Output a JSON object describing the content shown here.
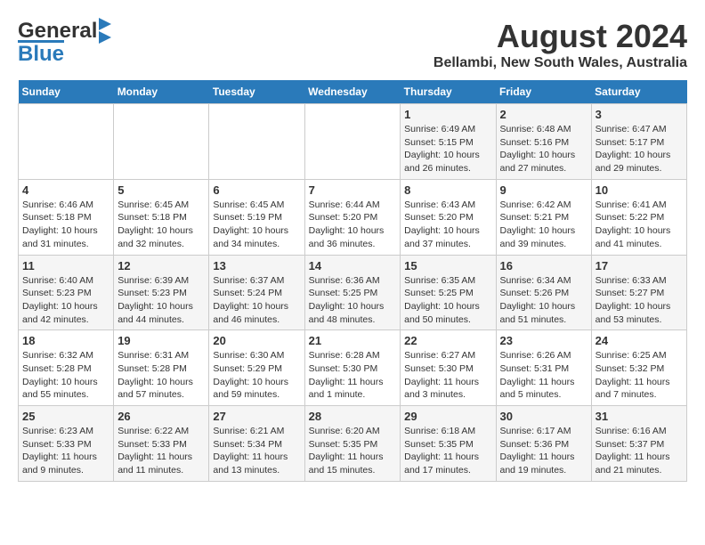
{
  "header": {
    "logo_general": "General",
    "logo_blue": "Blue",
    "title": "August 2024",
    "subtitle": "Bellambi, New South Wales, Australia"
  },
  "days_of_week": [
    "Sunday",
    "Monday",
    "Tuesday",
    "Wednesday",
    "Thursday",
    "Friday",
    "Saturday"
  ],
  "weeks": [
    [
      {
        "num": "",
        "sunrise": "",
        "sunset": "",
        "daylight": ""
      },
      {
        "num": "",
        "sunrise": "",
        "sunset": "",
        "daylight": ""
      },
      {
        "num": "",
        "sunrise": "",
        "sunset": "",
        "daylight": ""
      },
      {
        "num": "",
        "sunrise": "",
        "sunset": "",
        "daylight": ""
      },
      {
        "num": "1",
        "sunrise": "Sunrise: 6:49 AM",
        "sunset": "Sunset: 5:15 PM",
        "daylight": "Daylight: 10 hours and 26 minutes."
      },
      {
        "num": "2",
        "sunrise": "Sunrise: 6:48 AM",
        "sunset": "Sunset: 5:16 PM",
        "daylight": "Daylight: 10 hours and 27 minutes."
      },
      {
        "num": "3",
        "sunrise": "Sunrise: 6:47 AM",
        "sunset": "Sunset: 5:17 PM",
        "daylight": "Daylight: 10 hours and 29 minutes."
      }
    ],
    [
      {
        "num": "4",
        "sunrise": "Sunrise: 6:46 AM",
        "sunset": "Sunset: 5:18 PM",
        "daylight": "Daylight: 10 hours and 31 minutes."
      },
      {
        "num": "5",
        "sunrise": "Sunrise: 6:45 AM",
        "sunset": "Sunset: 5:18 PM",
        "daylight": "Daylight: 10 hours and 32 minutes."
      },
      {
        "num": "6",
        "sunrise": "Sunrise: 6:45 AM",
        "sunset": "Sunset: 5:19 PM",
        "daylight": "Daylight: 10 hours and 34 minutes."
      },
      {
        "num": "7",
        "sunrise": "Sunrise: 6:44 AM",
        "sunset": "Sunset: 5:20 PM",
        "daylight": "Daylight: 10 hours and 36 minutes."
      },
      {
        "num": "8",
        "sunrise": "Sunrise: 6:43 AM",
        "sunset": "Sunset: 5:20 PM",
        "daylight": "Daylight: 10 hours and 37 minutes."
      },
      {
        "num": "9",
        "sunrise": "Sunrise: 6:42 AM",
        "sunset": "Sunset: 5:21 PM",
        "daylight": "Daylight: 10 hours and 39 minutes."
      },
      {
        "num": "10",
        "sunrise": "Sunrise: 6:41 AM",
        "sunset": "Sunset: 5:22 PM",
        "daylight": "Daylight: 10 hours and 41 minutes."
      }
    ],
    [
      {
        "num": "11",
        "sunrise": "Sunrise: 6:40 AM",
        "sunset": "Sunset: 5:23 PM",
        "daylight": "Daylight: 10 hours and 42 minutes."
      },
      {
        "num": "12",
        "sunrise": "Sunrise: 6:39 AM",
        "sunset": "Sunset: 5:23 PM",
        "daylight": "Daylight: 10 hours and 44 minutes."
      },
      {
        "num": "13",
        "sunrise": "Sunrise: 6:37 AM",
        "sunset": "Sunset: 5:24 PM",
        "daylight": "Daylight: 10 hours and 46 minutes."
      },
      {
        "num": "14",
        "sunrise": "Sunrise: 6:36 AM",
        "sunset": "Sunset: 5:25 PM",
        "daylight": "Daylight: 10 hours and 48 minutes."
      },
      {
        "num": "15",
        "sunrise": "Sunrise: 6:35 AM",
        "sunset": "Sunset: 5:25 PM",
        "daylight": "Daylight: 10 hours and 50 minutes."
      },
      {
        "num": "16",
        "sunrise": "Sunrise: 6:34 AM",
        "sunset": "Sunset: 5:26 PM",
        "daylight": "Daylight: 10 hours and 51 minutes."
      },
      {
        "num": "17",
        "sunrise": "Sunrise: 6:33 AM",
        "sunset": "Sunset: 5:27 PM",
        "daylight": "Daylight: 10 hours and 53 minutes."
      }
    ],
    [
      {
        "num": "18",
        "sunrise": "Sunrise: 6:32 AM",
        "sunset": "Sunset: 5:28 PM",
        "daylight": "Daylight: 10 hours and 55 minutes."
      },
      {
        "num": "19",
        "sunrise": "Sunrise: 6:31 AM",
        "sunset": "Sunset: 5:28 PM",
        "daylight": "Daylight: 10 hours and 57 minutes."
      },
      {
        "num": "20",
        "sunrise": "Sunrise: 6:30 AM",
        "sunset": "Sunset: 5:29 PM",
        "daylight": "Daylight: 10 hours and 59 minutes."
      },
      {
        "num": "21",
        "sunrise": "Sunrise: 6:28 AM",
        "sunset": "Sunset: 5:30 PM",
        "daylight": "Daylight: 11 hours and 1 minute."
      },
      {
        "num": "22",
        "sunrise": "Sunrise: 6:27 AM",
        "sunset": "Sunset: 5:30 PM",
        "daylight": "Daylight: 11 hours and 3 minutes."
      },
      {
        "num": "23",
        "sunrise": "Sunrise: 6:26 AM",
        "sunset": "Sunset: 5:31 PM",
        "daylight": "Daylight: 11 hours and 5 minutes."
      },
      {
        "num": "24",
        "sunrise": "Sunrise: 6:25 AM",
        "sunset": "Sunset: 5:32 PM",
        "daylight": "Daylight: 11 hours and 7 minutes."
      }
    ],
    [
      {
        "num": "25",
        "sunrise": "Sunrise: 6:23 AM",
        "sunset": "Sunset: 5:33 PM",
        "daylight": "Daylight: 11 hours and 9 minutes."
      },
      {
        "num": "26",
        "sunrise": "Sunrise: 6:22 AM",
        "sunset": "Sunset: 5:33 PM",
        "daylight": "Daylight: 11 hours and 11 minutes."
      },
      {
        "num": "27",
        "sunrise": "Sunrise: 6:21 AM",
        "sunset": "Sunset: 5:34 PM",
        "daylight": "Daylight: 11 hours and 13 minutes."
      },
      {
        "num": "28",
        "sunrise": "Sunrise: 6:20 AM",
        "sunset": "Sunset: 5:35 PM",
        "daylight": "Daylight: 11 hours and 15 minutes."
      },
      {
        "num": "29",
        "sunrise": "Sunrise: 6:18 AM",
        "sunset": "Sunset: 5:35 PM",
        "daylight": "Daylight: 11 hours and 17 minutes."
      },
      {
        "num": "30",
        "sunrise": "Sunrise: 6:17 AM",
        "sunset": "Sunset: 5:36 PM",
        "daylight": "Daylight: 11 hours and 19 minutes."
      },
      {
        "num": "31",
        "sunrise": "Sunrise: 6:16 AM",
        "sunset": "Sunset: 5:37 PM",
        "daylight": "Daylight: 11 hours and 21 minutes."
      }
    ]
  ]
}
